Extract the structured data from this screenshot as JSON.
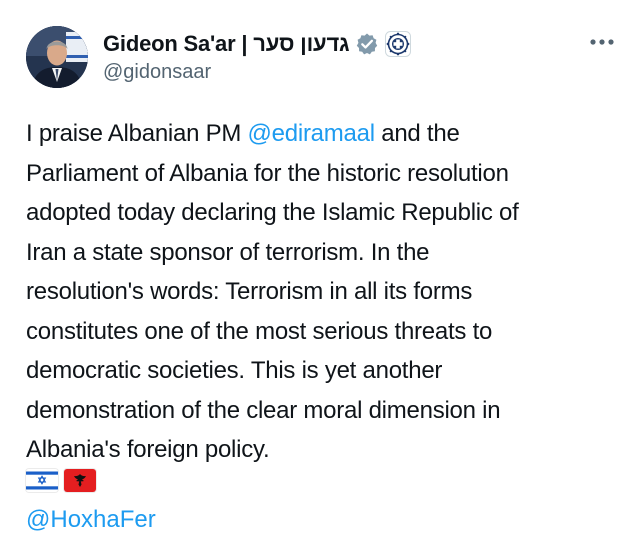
{
  "author": {
    "display_name": "Gideon Sa'ar | גדעון סער",
    "handle": "@gidonsaar",
    "badges": [
      "verified-gray-checkmark-icon",
      "government-seal-icon"
    ],
    "avatar": "profile-photo"
  },
  "menu": {
    "icon": "more-horizontal-icon"
  },
  "tweet": {
    "lines": [
      {
        "before": "I praise Albanian PM ",
        "mention": "@ediramaal",
        "after": " and the"
      },
      {
        "text": "Parliament of Albania for the historic resolution"
      },
      {
        "text": "adopted today declaring the Islamic Republic of"
      },
      {
        "text": "Iran a state sponsor of terrorism. In the"
      },
      {
        "text": "resolution's words: Terrorism in all its forms"
      },
      {
        "text": "constitutes one of the most serious threats to"
      },
      {
        "text": "democratic societies. This is yet another"
      },
      {
        "text": "demonstration of the clear moral dimension in"
      },
      {
        "text": "Albania's foreign policy."
      }
    ],
    "flags": [
      "israel-flag-icon",
      "albania-flag-icon"
    ],
    "footer_mention": "@HoxhaFer"
  },
  "colors": {
    "link": "#1d9bf0",
    "text": "#0f1419",
    "secondary": "#536471",
    "verified_badge": "#829aab"
  }
}
